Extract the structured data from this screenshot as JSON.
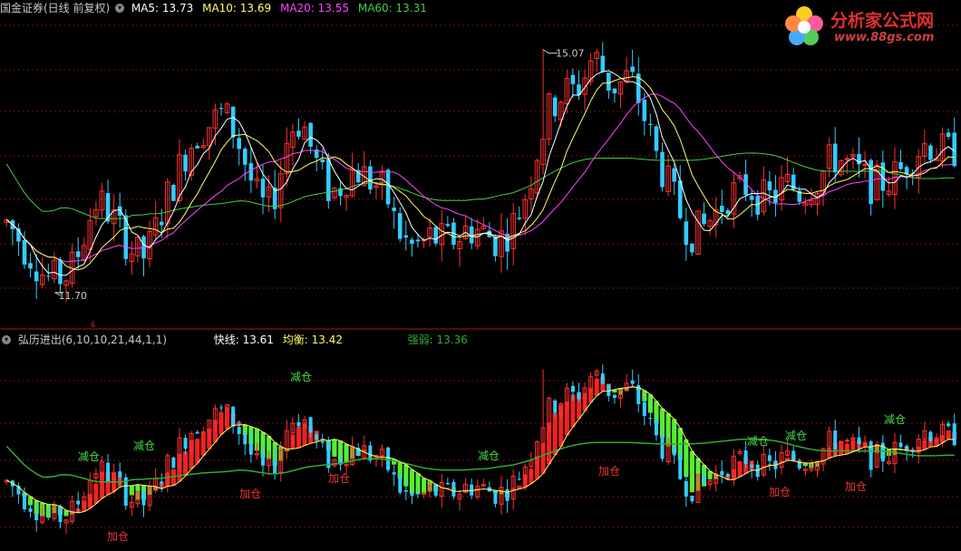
{
  "top_legend": {
    "title": "国金证券(日线 前复权)",
    "ma5": "MA5: 13.73",
    "ma10": "MA10: 13.69",
    "ma20": "MA20: 13.55",
    "ma60": "MA60: 13.31",
    "colors": {
      "ma5": "#ffffff",
      "ma10": "#ffff66",
      "ma20": "#ff44ff",
      "ma60": "#44cc44",
      "up": "#ff3030",
      "down": "#33ccff"
    }
  },
  "bottom_legend": {
    "title": "弘历进出(6,10,10,21,44,1,1)",
    "fast": "快线: 13.61",
    "balance": "均衡: 13.42",
    "strength": "强弱: 13.36",
    "colors": {
      "fast": "#ffffff",
      "balance": "#ffff66",
      "strength": "#33aa33"
    }
  },
  "watermark": {
    "cn": "分析家公式网",
    "url": "www.88gs.com"
  },
  "annotations": {
    "high": "15.07",
    "low": "11.70"
  },
  "labels": {
    "jian": "减仓",
    "jia": "加仓"
  },
  "chart_data": {
    "type": "candlestick",
    "title": "国金证券(日线 前复权)",
    "ylim": [
      11.3,
      15.5
    ],
    "high_label": 15.07,
    "low_label": 11.7,
    "ma_last": {
      "MA5": 13.73,
      "MA10": 13.69,
      "MA20": 13.55,
      "MA60": 13.31
    },
    "indicator": {
      "name": "弘历进出(6,10,10,21,44,1,1)",
      "快线": 13.61,
      "均衡": 13.42,
      "强弱": 13.36
    },
    "ma5_path": [
      12.7,
      12.55,
      12.35,
      12.2,
      12.0,
      11.9,
      11.95,
      12.0,
      12.3,
      12.7,
      13.0,
      12.9,
      12.7,
      12.5,
      12.3,
      12.2,
      12.4,
      12.8,
      13.1,
      13.4,
      13.7,
      13.9,
      14.0,
      14.1,
      14.2,
      14.0,
      13.7,
      13.3,
      12.95,
      12.9,
      13.2,
      13.8,
      14.1,
      14.0,
      13.6,
      13.3,
      13.1,
      13.2,
      13.4,
      13.4,
      13.3,
      13.2,
      13.1,
      12.7,
      12.45,
      12.35,
      12.4,
      12.5,
      12.45,
      12.45,
      12.5,
      12.6,
      12.6,
      12.55,
      12.45,
      12.5,
      12.65,
      12.9,
      13.3,
      13.8,
      14.2,
      14.4,
      14.5,
      14.5,
      14.7,
      15.0,
      14.8,
      14.55,
      14.6,
      14.7,
      14.4,
      14.0,
      13.6,
      13.3,
      13.0,
      12.7,
      12.55,
      12.6,
      12.75,
      12.9,
      13.1,
      13.1,
      13.2,
      13.1,
      13.0,
      13.05,
      13.2,
      13.2,
      13.1,
      13.2,
      13.3,
      13.5,
      13.6,
      13.5,
      13.4,
      13.3,
      13.2,
      13.25,
      13.3,
      13.4,
      13.6,
      13.7,
      13.8,
      13.7,
      13.65,
      13.7
    ],
    "ma60_path": [
      13.5,
      13.3,
      13.1,
      12.95,
      12.85,
      12.85,
      12.9,
      12.9,
      12.85,
      12.8,
      12.75,
      12.75,
      12.75,
      12.75,
      12.8,
      12.8,
      12.82,
      12.82,
      12.85,
      12.88,
      12.9,
      12.92,
      12.94,
      12.95,
      12.96,
      12.98,
      13.0,
      12.98,
      12.95,
      12.92,
      12.92,
      12.95,
      13.0,
      13.05,
      13.08,
      13.1,
      13.12,
      13.14,
      13.18,
      13.22,
      13.24,
      13.24,
      13.22,
      13.19,
      13.15,
      13.1,
      13.05,
      13.02,
      13.0,
      13.0,
      13.0,
      13.0,
      13.02,
      13.02,
      13.05,
      13.08,
      13.1,
      13.15,
      13.2,
      13.28,
      13.35,
      13.42,
      13.48,
      13.53,
      13.56,
      13.58,
      13.58,
      13.58,
      13.58,
      13.58,
      13.57,
      13.56,
      13.55,
      13.55,
      13.55,
      13.55,
      13.55,
      13.56,
      13.58,
      13.6,
      13.62,
      13.64,
      13.65,
      13.65,
      13.64,
      13.62,
      13.58,
      13.53,
      13.48,
      13.44,
      13.41,
      13.4,
      13.4,
      13.4,
      13.4,
      13.4,
      13.4,
      13.4,
      13.38,
      13.35,
      13.32,
      13.3,
      13.3,
      13.3,
      13.31,
      13.31
    ]
  }
}
